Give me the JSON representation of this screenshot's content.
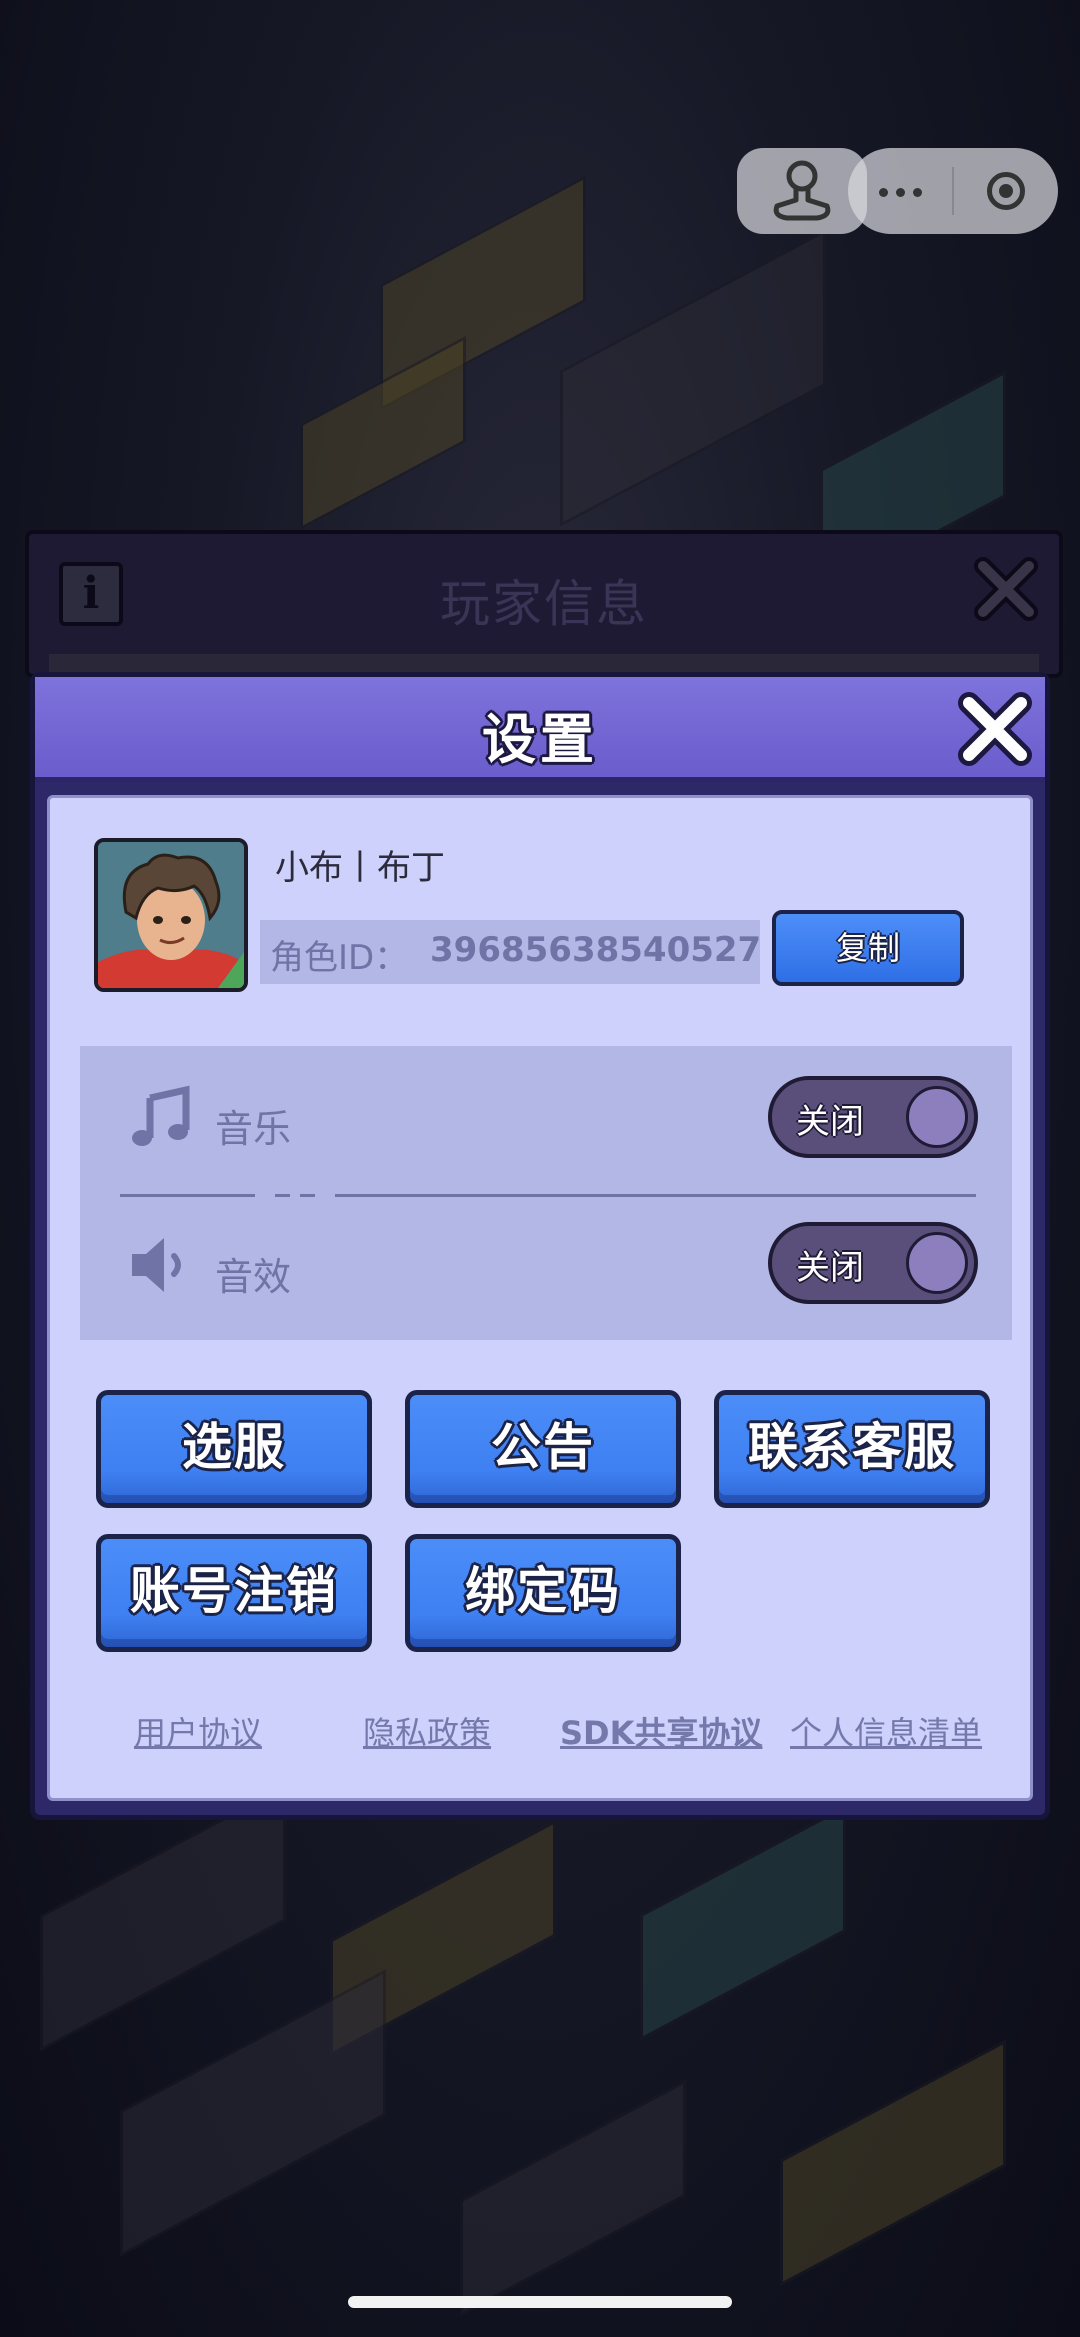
{
  "background_panel": {
    "title": "玩家信息"
  },
  "settings": {
    "title": "设置",
    "player": {
      "name": "小布丨布丁",
      "id_label": "角色ID：",
      "id_value": "39685638540527",
      "copy_label": "复制"
    },
    "sound": {
      "music": {
        "label": "音乐",
        "toggle_label": "关闭",
        "icon": "music-note-icon"
      },
      "effects": {
        "label": "音效",
        "toggle_label": "关闭",
        "icon": "speaker-icon"
      }
    },
    "buttons": [
      "选服",
      "公告",
      "联系客服",
      "账号注销",
      "绑定码"
    ],
    "links": [
      "用户协议",
      "隐私政策",
      "SDK共享协议",
      "个人信息清单"
    ]
  },
  "colors": {
    "header": "#6a5dcc",
    "body": "#cdd1fb",
    "button": "#3f80f2",
    "toggle_off": "#5a4f7b"
  }
}
